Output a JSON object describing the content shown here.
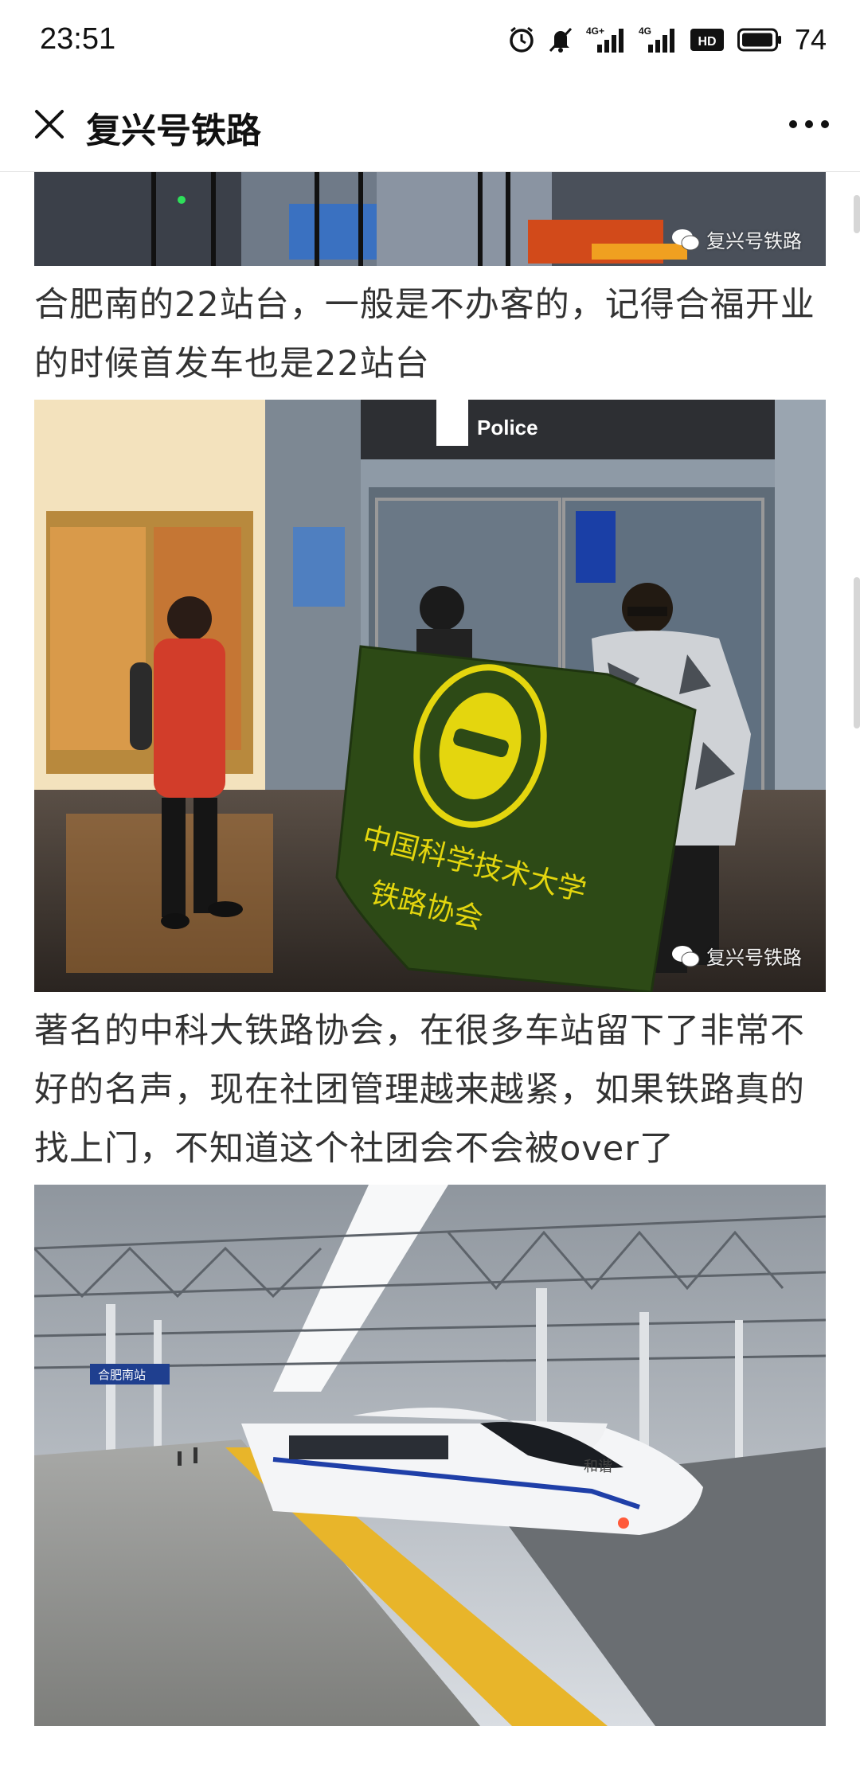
{
  "status_bar": {
    "time": "23:51",
    "icons": [
      "alarm-icon",
      "mute-icon",
      "signal-4g-plus-icon",
      "signal-4g-icon",
      "hd-icon",
      "battery-icon"
    ],
    "signal_labels": [
      "4G+",
      "4G"
    ],
    "hd_label": "HD",
    "battery": "74"
  },
  "nav": {
    "title": "复兴号铁路",
    "close_icon": "close-icon",
    "more_icon": "more-icon"
  },
  "article": {
    "watermark": "复兴号铁路",
    "captions": [
      "合肥南的22站台，一般是不办客的，记得合福开业的时候首发车也是22站台",
      "著名的中科大铁路协会，在很多车站留下了非常不好的名声，现在社团管理越来越紧，如果铁路真的找上门，不知道这个社团会不会被over了"
    ],
    "photo2_sign": "Police",
    "photo2_flag_lines": [
      "中国科学技术大学",
      "铁路协会"
    ],
    "photo3_sign": "合肥南站",
    "photo3_train_label": "和谐"
  },
  "colors": {
    "accent": "#111111",
    "caption": "#333333"
  }
}
